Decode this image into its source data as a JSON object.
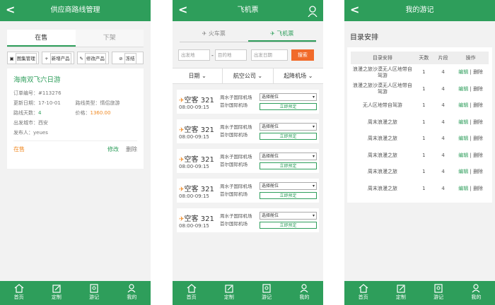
{
  "s1": {
    "title": "供应商路线管理",
    "tabs": [
      "在售",
      "下架"
    ],
    "actions": [
      "图集管理",
      "新增产品",
      "修改产品",
      "冻结"
    ],
    "card": {
      "name": "海南双飞六日游",
      "order": "订单编号：#113276",
      "updated": "更新日期：17-10-01",
      "rtype": "路线类型：情侣旅游",
      "days_label": "路线天数：",
      "days": "4",
      "price_label": "价格：",
      "price": "1360.00",
      "city": "出发城市：西安",
      "publisher": "发布人：yeues",
      "status": "在售",
      "edit": "修改",
      "delete": "删除"
    }
  },
  "s2": {
    "title": "飞机票",
    "tabs": [
      "火车票",
      "飞机票"
    ],
    "from": "出发地",
    "dash": "-",
    "to": "目的地",
    "date": "出发日期",
    "search": "搜索",
    "filters": [
      "日期",
      "航空公司",
      "起降机场"
    ],
    "flights": [
      {
        "no": "空客 321",
        "time": "08:00-09:15",
        "a1": "周水子国际机场",
        "a2": "首尔国际机场",
        "sel": "选择舱位",
        "book": "立即预定"
      },
      {
        "no": "空客 321",
        "time": "08:00-09:15",
        "a1": "周水子国际机场",
        "a2": "首尔国际机场",
        "sel": "选择舱位",
        "book": "立即预定"
      },
      {
        "no": "空客 321",
        "time": "08:00-09:15",
        "a1": "周水子国际机场",
        "a2": "首尔国际机场",
        "sel": "选择舱位",
        "book": "立即预定"
      },
      {
        "no": "空客 321",
        "time": "08:00-09:15",
        "a1": "周水子国际机场",
        "a2": "首尔国际机场",
        "sel": "选择舱位",
        "book": "立即预定"
      },
      {
        "no": "空客 321",
        "time": "08:00-09:15",
        "a1": "周水子国际机场",
        "a2": "首尔国际机场",
        "sel": "选择舱位",
        "book": "立即预定"
      }
    ]
  },
  "s3": {
    "title": "我的游记",
    "section": "目录安排",
    "headers": [
      "目录安排",
      "天数",
      "片段",
      "操作"
    ],
    "rows": [
      {
        "name": "浪漫之旅沙漠无人区地带自驾游",
        "days": "1",
        "seg": "4"
      },
      {
        "name": "浪漫之旅沙漠无人区地带自驾游",
        "days": "1",
        "seg": "4"
      },
      {
        "name": "无人区地带自驾游",
        "days": "1",
        "seg": "4"
      },
      {
        "name": "周末浪漫之旅",
        "days": "1",
        "seg": "4"
      },
      {
        "name": "周末浪漫之旅",
        "days": "1",
        "seg": "4"
      },
      {
        "name": "周末浪漫之旅",
        "days": "1",
        "seg": "4"
      },
      {
        "name": "周末浪漫之旅",
        "days": "1",
        "seg": "4"
      },
      {
        "name": "周末浪漫之旅",
        "days": "1",
        "seg": "4"
      }
    ],
    "edit": "编辑",
    "sep": "|",
    "delete": "删除"
  },
  "tabbar": [
    "首页",
    "定制",
    "游记",
    "我的"
  ],
  "colors": {
    "primary": "#2e9e5b",
    "accent": "#f16a2a"
  }
}
